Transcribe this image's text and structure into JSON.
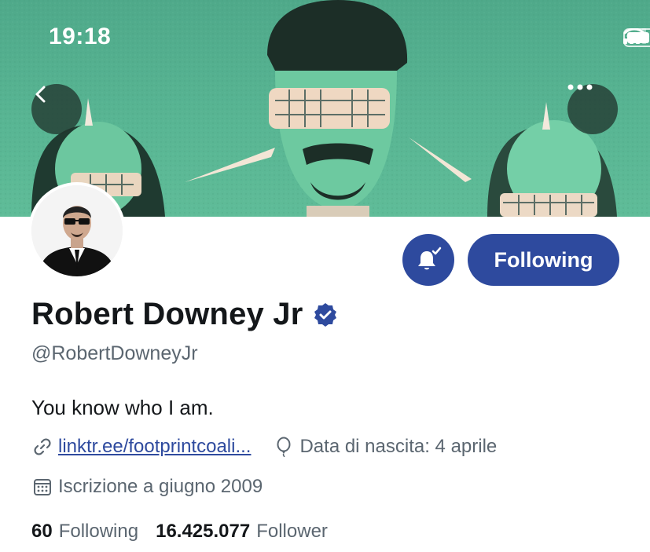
{
  "status_bar": {
    "time": "19:18"
  },
  "header": {
    "back_icon": "chevron-left-icon",
    "more_icon": "more-horizontal-icon"
  },
  "profile": {
    "name": "Robert Downey Jr",
    "verified": true,
    "handle": "@RobertDowneyJr",
    "bio": "You know who I am.",
    "link_text": "linktr.ee/footprintcoali...",
    "birthday": "Data di nascita: 4 aprile",
    "joined": "Iscrizione a giugno 2009"
  },
  "actions": {
    "follow_label": "Following",
    "notifications_icon": "bell-check-icon"
  },
  "stats": {
    "following_count": "60",
    "following_label": "Following",
    "followers_count": "16.425.077",
    "followers_label": "Follower"
  },
  "colors": {
    "accent": "#2e4a9e",
    "banner_green": "#58b593",
    "secondary_text": "#5b6670"
  }
}
